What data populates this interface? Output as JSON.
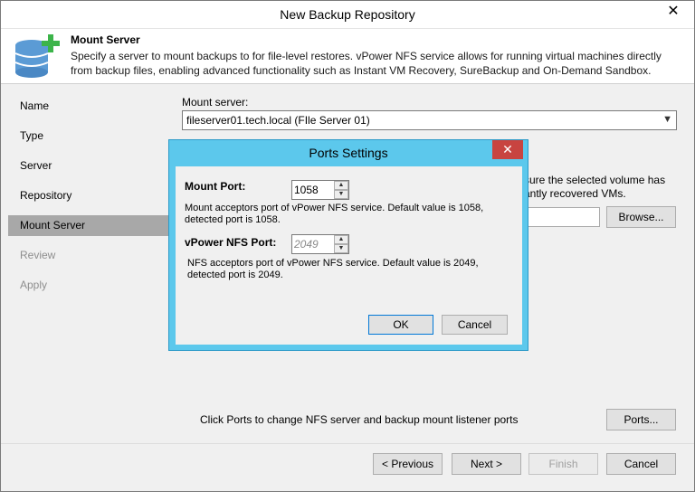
{
  "window": {
    "title": "New Backup Repository",
    "close": "✕"
  },
  "header": {
    "title": "Mount Server",
    "description": "Specify a server to mount backups to for file-level restores. vPower NFS service allows for running virtual machines directly from backup files, enabling advanced functionality such as Instant VM Recovery, SureBackup and On-Demand Sandbox."
  },
  "steps": [
    {
      "label": "Name",
      "state": "normal"
    },
    {
      "label": "Type",
      "state": "normal"
    },
    {
      "label": "Server",
      "state": "normal"
    },
    {
      "label": "Repository",
      "state": "normal"
    },
    {
      "label": "Mount Server",
      "state": "active"
    },
    {
      "label": "Review",
      "state": "disabled"
    },
    {
      "label": "Apply",
      "state": "disabled"
    }
  ],
  "main": {
    "mount_server_label": "Mount server:",
    "mount_server_value": "fileserver01.tech.local (FIle Server 01)",
    "partial_text_1": "sure the selected volume has",
    "partial_text_2": "antly recovered VMs.",
    "browse": "Browse...",
    "ports_hint": "Click Ports to change NFS server and backup mount listener ports",
    "ports": "Ports..."
  },
  "footer": {
    "previous": "< Previous",
    "next": "Next >",
    "finish": "Finish",
    "cancel": "Cancel"
  },
  "dialog": {
    "title": "Ports Settings",
    "close": "✕",
    "mount_port_label": "Mount Port:",
    "mount_port_value": "1058",
    "mount_port_desc": "Mount acceptors port of vPower NFS service. Default value is 1058, detected port is 1058.",
    "nfs_port_label": "vPower NFS Port:",
    "nfs_port_value": "2049",
    "nfs_port_desc": "NFS acceptors port of vPower NFS service. Default value is 2049, detected port is 2049.",
    "ok": "OK",
    "cancel": "Cancel"
  },
  "colors": {
    "dialog_frame": "#5cc8ec",
    "dialog_close": "#c84440",
    "active_step": "#a8a8a8",
    "icon_plus": "#3cb44a",
    "icon_db": "#5b9bd5"
  }
}
